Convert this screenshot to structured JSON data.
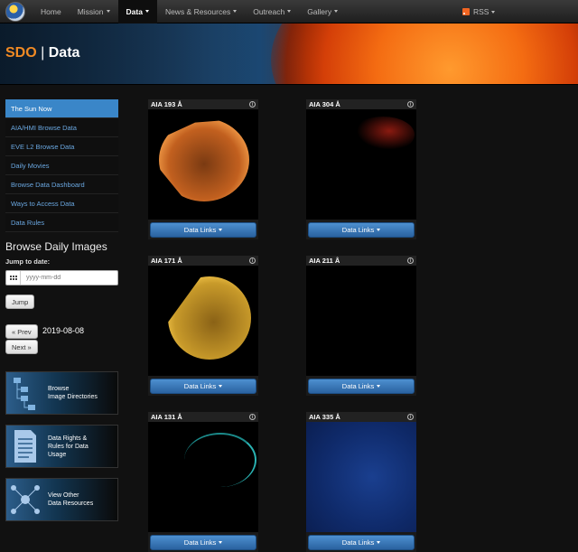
{
  "nav": {
    "items": [
      "Home",
      "Mission",
      "Data",
      "News & Resources",
      "Outreach",
      "Gallery"
    ],
    "rss_label": "RSS"
  },
  "banner": {
    "sdo": "SDO",
    "sep": "|",
    "section": "Data"
  },
  "sidebar": {
    "items": [
      "The Sun Now",
      "AIA/HMI Browse Data",
      "EVE L2 Browse Data",
      "Daily Movies",
      "Browse Data Dashboard",
      "Ways to Access Data",
      "Data Rules"
    ]
  },
  "browse": {
    "title": "Browse Daily Images",
    "jump_label": "Jump to date:",
    "date_placeholder": "yyyy-mm-dd",
    "jump_button": "Jump",
    "prev_button": "« Prev",
    "next_button": "Next »",
    "current_date": "2019-08-08"
  },
  "cards": [
    {
      "line1": "Browse",
      "line2": "Image Directories",
      "line3": ""
    },
    {
      "line1": "Data Rights &",
      "line2": "Rules for Data",
      "line3": "Usage"
    },
    {
      "line1": "View Other",
      "line2": "Data Resources",
      "line3": ""
    }
  ],
  "panels": [
    {
      "title": "AIA 193 Å",
      "button": "Data Links"
    },
    {
      "title": "AIA 304 Å",
      "button": "Data Links"
    },
    {
      "title": "AIA 171 Å",
      "button": "Data Links"
    },
    {
      "title": "AIA 211 Å",
      "button": "Data Links"
    },
    {
      "title": "AIA 131 Å",
      "button": "Data Links"
    },
    {
      "title": "AIA 335 Å",
      "button": "Data Links"
    }
  ],
  "colors": {
    "accent": "#3a86c8",
    "brand_orange": "#f08a24"
  }
}
